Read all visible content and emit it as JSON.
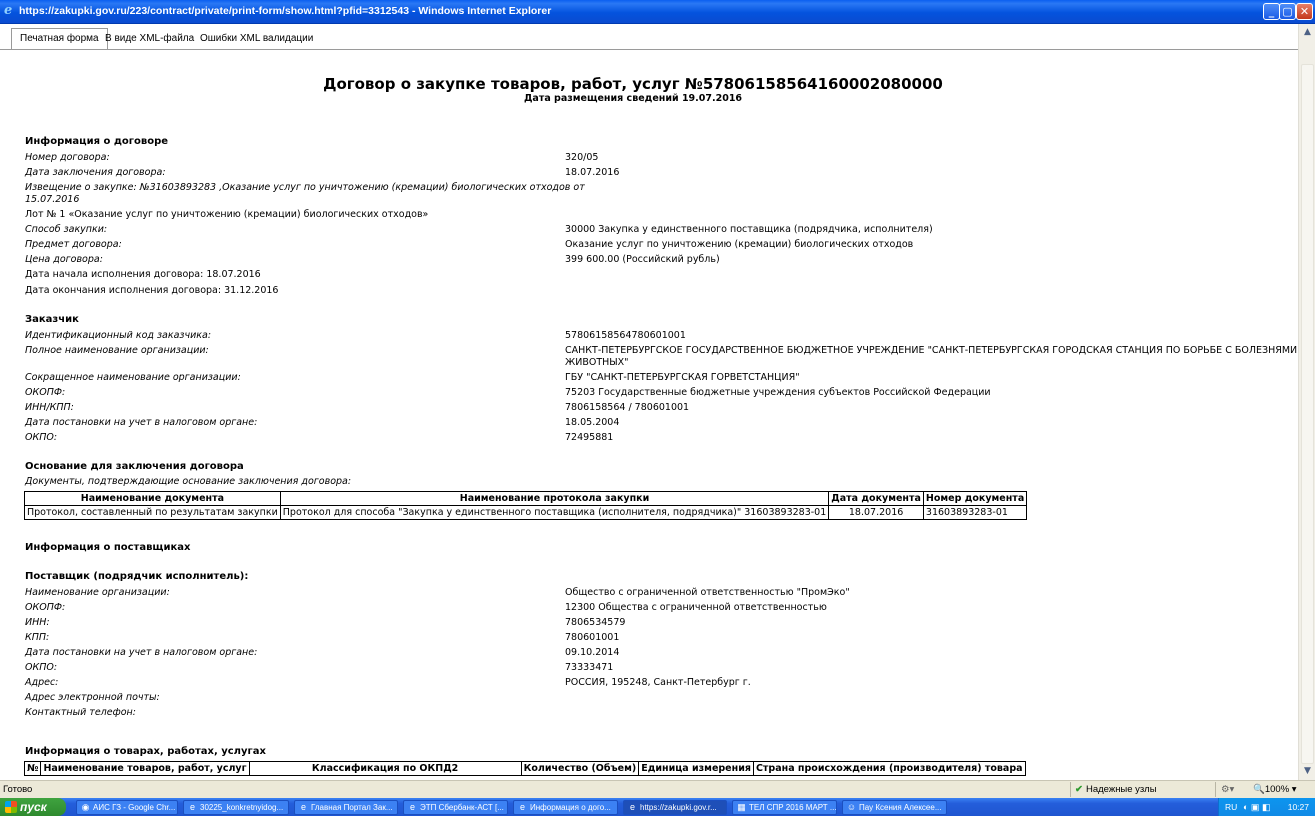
{
  "window": {
    "title": "https://zakupki.gov.ru/223/contract/private/print-form/show.html?pfid=3312543 - Windows Internet Explorer",
    "min_label": "_",
    "max_label": "▢",
    "close_label": "✕"
  },
  "tabs": [
    {
      "label": "Печатная форма",
      "active": true
    },
    {
      "label": "В виде XML-файла",
      "active": false
    },
    {
      "label": "Ошибки XML валидации",
      "active": false
    }
  ],
  "doc": {
    "title": "Договор о закупке товаров, работ, услуг №57806158564160002080000",
    "subtitle": "Дата размещения сведений 19.07.2016",
    "contract_info": {
      "heading": "Информация о договоре",
      "number_label": "Номер договора:",
      "number_value": "320/05",
      "date_label": "Дата заключения договора:",
      "date_value": "18.07.2016",
      "notice_line1": "Извещение о закупке: №31603893283 ,Оказание услуг по уничтожению (кремации) биологических отходов от",
      "notice_line2": "15.07.2016",
      "lot": "Лот № 1 «Оказание услуг по уничтожению (кремации) биологических отходов»",
      "method_label": "Способ закупки:",
      "method_value": "30000 Закупка у единственного поставщика (подрядчика, исполнителя)",
      "subject_label": "Предмет договора:",
      "subject_value": "Оказание услуг по уничтожению (кремации) биологических отходов",
      "price_label": "Цена договора:",
      "price_value": "399 600.00 (Российский рубль)",
      "start": "Дата начала исполнения договора: 18.07.2016",
      "end": "Дата окончания исполнения договора: 31.12.2016"
    },
    "customer": {
      "heading": "Заказчик",
      "id_label": "Идентификационный код заказчика:",
      "id_value": "57806158564780601001",
      "fullname_label": "Полное наименование организации:",
      "fullname_line1": "САНКТ-ПЕТЕРБУРГСКОЕ ГОСУДАРСТВЕННОЕ БЮДЖЕТНОЕ УЧРЕЖДЕНИЕ \"САНКТ-ПЕТЕРБУРГСКАЯ ГОРОДСКАЯ СТАНЦИЯ ПО БОРЬБЕ С БОЛЕЗНЯМИ",
      "fullname_line2": "ЖИВОТНЫХ\"",
      "shortname_label": "Сокращенное наименование организации:",
      "shortname_value": "ГБУ \"САНКТ-ПЕТЕРБУРГСКАЯ ГОРВЕТСТАНЦИЯ\"",
      "okopf_label": "ОКОПФ:",
      "okopf_value": "75203 Государственные бюджетные учреждения субъектов Российской Федерации",
      "inn_label": "ИНН/КПП:",
      "inn_value": "7806158564 / 780601001",
      "tax_date_label": "Дата постановки на учет в налоговом органе:",
      "tax_date_value": "18.05.2004",
      "okpo_label": "ОКПО:",
      "okpo_value": "72495881"
    },
    "basis": {
      "heading": "Основание для заключения договора",
      "subheading": "Документы, подтверждающие основание заключения договора:",
      "columns": [
        "Наименование документа",
        "Наименование протокола закупки",
        "Дата документа",
        "Номер документа"
      ],
      "rows": [
        [
          "Протокол, составленный по результатам закупки",
          "Протокол для способа \"Закупка у единственного поставщика (исполнителя, подрядчика)\" 31603893283-01",
          "18.07.2016",
          "31603893283-01"
        ]
      ]
    },
    "suppliers_heading": "Информация о поставщиках",
    "supplier": {
      "heading": "Поставщик (подрядчик исполнитель):",
      "name_label": "Наименование организации:",
      "name_value": "Общество с ограниченной ответственностью \"ПромЭко\"",
      "okopf_label": "ОКОПФ:",
      "okopf_value": "12300 Общества с ограниченной ответственностью",
      "inn_label": "ИНН:",
      "inn_value": "7806534579",
      "kpp_label": "КПП:",
      "kpp_value": "780601001",
      "tax_date_label": "Дата постановки на учет в налоговом органе:",
      "tax_date_value": "09.10.2014",
      "okpo_label": "ОКПО:",
      "okpo_value": "73333471",
      "address_label": "Адрес:",
      "address_value": "РОССИЯ, 195248, Санкт-Петербург г.",
      "email_label": "Адрес электронной почты:",
      "phone_label": "Контактный телефон:"
    },
    "goods": {
      "heading": "Информация о товарах, работах, услугах",
      "columns": [
        "№",
        "Наименование товаров, работ, услуг",
        "Классификация по ОКПД2",
        "Количество (Объем)",
        "Единица измерения",
        "Страна происхождения (производителя) товара"
      ]
    }
  },
  "statusbar": {
    "text": "Готово",
    "zone": "Надежные узлы",
    "zoom": "100%"
  },
  "taskbar": {
    "start": "пуск",
    "items": [
      "АИС ГЗ - Google Chr...",
      "30225_konkretnyidog...",
      "Главная Портал Зак...",
      "ЭТП Сбербанк-АСТ [...",
      "Информация о дого...",
      "https://zakupki.gov.r...",
      "ТЕЛ СПР 2016 МАРТ ...",
      "Пау Ксения Алексее..."
    ],
    "lang": "RU",
    "clock": "10:27"
  }
}
